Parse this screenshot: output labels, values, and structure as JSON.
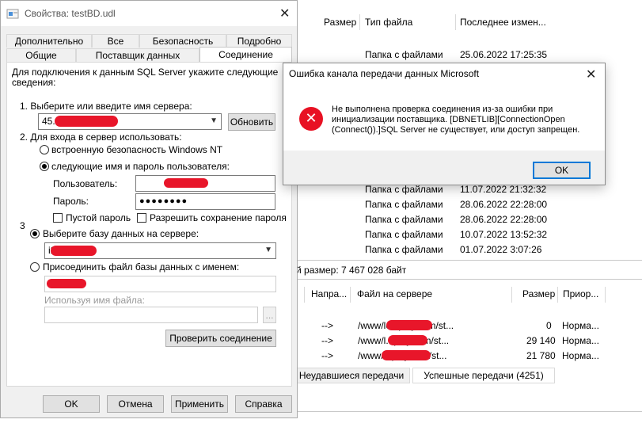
{
  "file_manager": {
    "columns": [
      "Размер",
      "Тип файла",
      "Последнее измен..."
    ],
    "rows": [
      {
        "type": "Папка с файлами",
        "date": "25.06.2022 17:25:35"
      },
      {
        "type": "Папка с файлами",
        "date": "11.07.2022 21:32:32"
      },
      {
        "type": "Папка с файлами",
        "date": "28.06.2022 22:28:00"
      },
      {
        "type": "Папка с файлами",
        "date": "28.06.2022 22:28:00"
      },
      {
        "type": "Папка с файлами",
        "date": "10.07.2022 13:52:32"
      },
      {
        "type": "Папка с файлами",
        "date": "01.07.2022 3:07:26"
      }
    ],
    "total_size": "й размер: 7 467 028 байт",
    "queue_columns": [
      "Напра...",
      "Файл на сервере",
      "Размер",
      "Приор..."
    ],
    "queue_rows": [
      {
        "dir": "-->",
        "file": "/www/lc...play.com/st...",
        "size": "0",
        "priority": "Норма..."
      },
      {
        "dir": "-->",
        "file": "/www/l...play.com/st...",
        "size": "29 140",
        "priority": "Норма..."
      },
      {
        "dir": "-->",
        "file": "/www/...play.com/st...",
        "size": "21 780",
        "priority": "Норма..."
      }
    ],
    "tabs": [
      "Неудавшиеся передачи",
      "Успешные передачи (4251)"
    ]
  },
  "props": {
    "title": "Свойства: testBD.udl",
    "tabs_row1": [
      "Дополнительно",
      "Все",
      "Безопасность",
      "Подробно"
    ],
    "tabs_row2": [
      "Общие",
      "Поставщик данных",
      "Соединение"
    ],
    "intro": "Для подключения к данным SQL Server укажите следующие сведения:",
    "step1": "1. Выберите или введите имя сервера:",
    "server_value": "45.1",
    "refresh_label": "Обновить",
    "step2": "2. Для входа в сервер использовать:",
    "opt_nt": "встроенную безопасность Windows NT",
    "opt_user": "следующие имя и пароль пользователя:",
    "user_label": "Пользователь:",
    "password_label": "Пароль:",
    "password_value": "●●●●●●●●",
    "blank_pw": "Пустой пароль",
    "save_pw": "Разрешить сохранение пароля",
    "step3": "3",
    "opt_db": "Выберите базу данных на сервере:",
    "db_value": "i2",
    "opt_attach": "Присоединить файл базы данных с именем:",
    "using_filename": "Используя имя файла:",
    "browse": "...",
    "test_btn": "Проверить соединение",
    "ok": "OK",
    "cancel": "Отмена",
    "apply": "Применить",
    "help": "Справка"
  },
  "error": {
    "title": "Ошибка канала передачи данных Microsoft",
    "message": "Не выполнена проверка соединения из-за ошибки при инициализации поставщика. [DBNETLIB][ConnectionOpen (Connect()).]SQL Server не существует, или доступ запрещен.",
    "ok": "OK"
  }
}
